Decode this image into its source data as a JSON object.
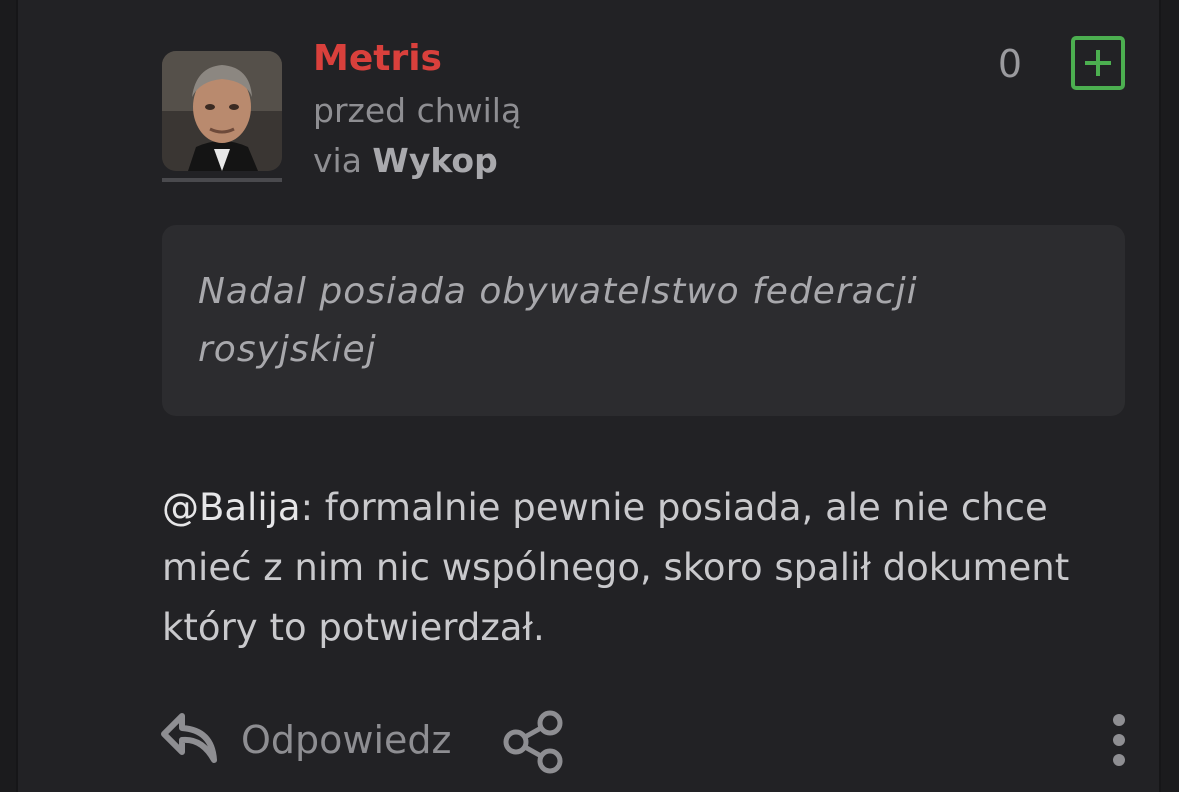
{
  "entry": {
    "author": "Metris",
    "time": "przed chwilą",
    "via_prefix": "via",
    "via_source": "Wykop",
    "vote_count": "0",
    "quote": "Nadal posiada obywatelstwo federacji rosyjskiej",
    "mention": "@Balija",
    "body": ": formalnie pewnie posiada, ale nie chce mieć z nim nic wspólnego, skoro spalił dokument który to potwierdzał."
  },
  "actions": {
    "reply_label": "Odpowiedz"
  },
  "colors": {
    "author": "#d9403c",
    "plus_accent": "#4caf50",
    "background": "#222225",
    "quote_background": "#2c2c2f"
  },
  "icons": [
    "plus-icon",
    "reply-icon",
    "share-icon",
    "more-icon"
  ]
}
